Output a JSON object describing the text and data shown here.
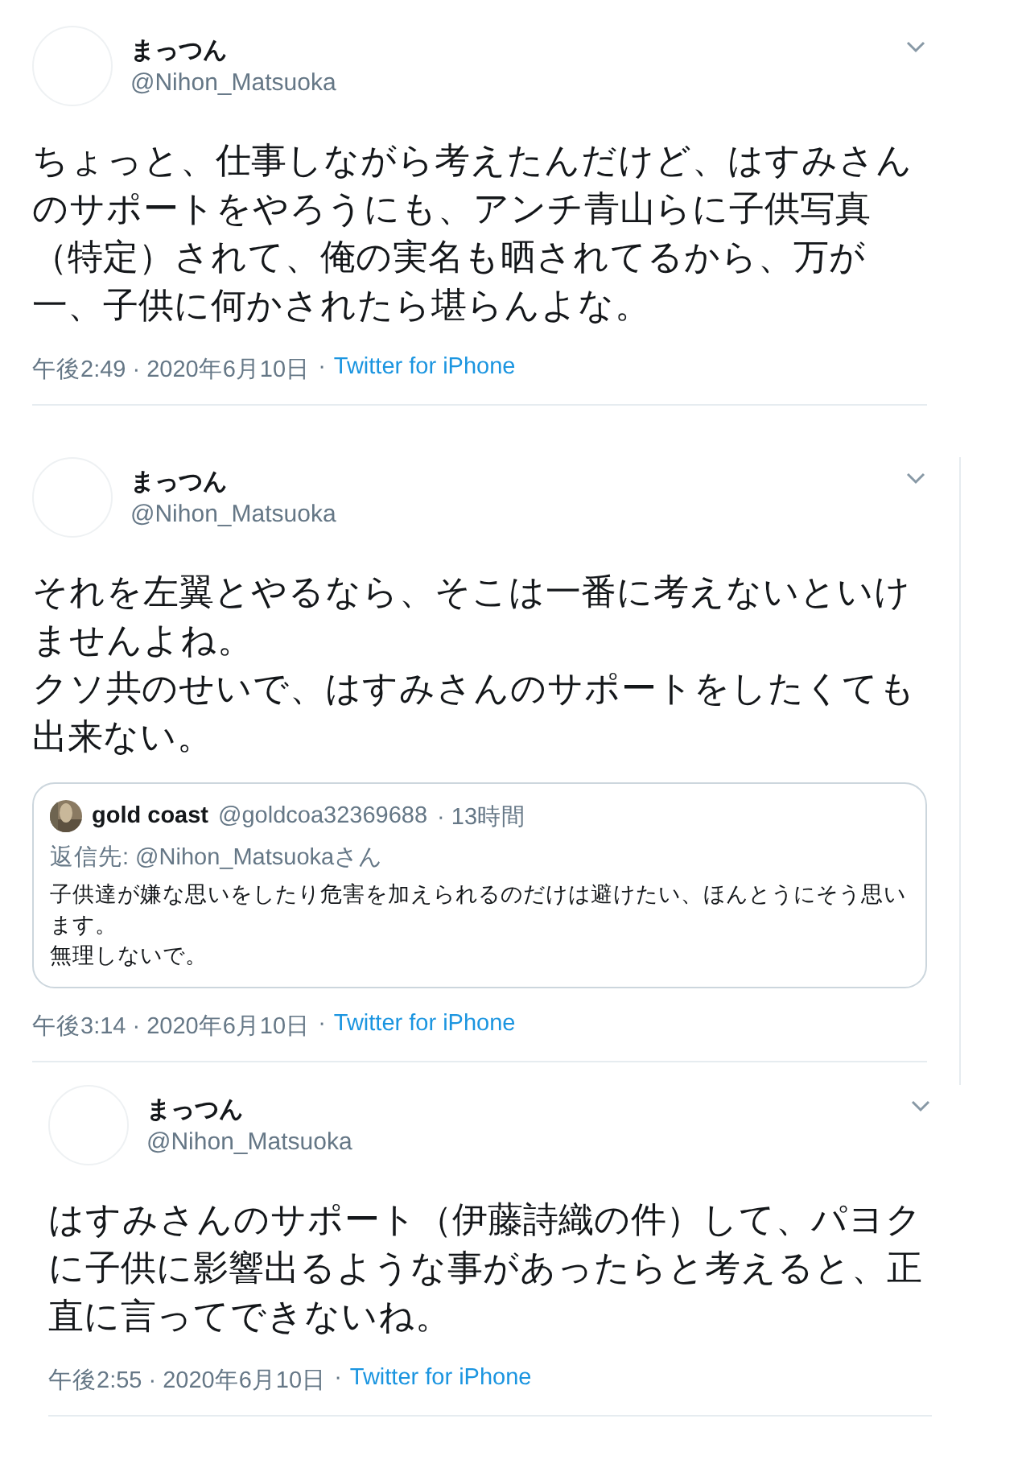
{
  "tweets": [
    {
      "name": "まっつん",
      "handle": "@Nihon_Matsuoka",
      "text": "ちょっと、仕事しながら考えたんだけど、はすみさんのサポートをやろうにも、アンチ青山らに子供写真（特定）されて、俺の実名も晒されてるから、万が一、子供に何かされたら堪らんよな。",
      "time": "午後2:49 · 2020年6月10日",
      "separator": "·",
      "source": "Twitter for iPhone",
      "indent": false,
      "thread_line": false
    },
    {
      "name": "まっつん",
      "handle": "@Nihon_Matsuoka",
      "text": "それを左翼とやるなら、そこは一番に考えないといけませんよね。",
      "text_2": "クソ共のせいで、はすみさんのサポートをしたくても出来ない。",
      "quote": {
        "name": "gold coast",
        "handle": "@goldcoa32369688",
        "age": "· 13時間",
        "reply_to": "返信先: @Nihon_Matsuokaさん",
        "text": "子供達が嫌な思いをしたり危害を加えられるのだけは避けたい、ほんとうにそう思います。",
        "text_2": "無理しないで。"
      },
      "time": "午後3:14 · 2020年6月10日",
      "separator": "·",
      "source": "Twitter for iPhone",
      "indent": false,
      "thread_line": true
    },
    {
      "name": "まっつん",
      "handle": "@Nihon_Matsuoka",
      "text": "はすみさんのサポート（伊藤詩織の件）して、パヨクに子供に影響出るような事があったらと考えると、正直に言ってできないね。",
      "time": "午後2:55 · 2020年6月10日",
      "separator": "·",
      "source": "Twitter for iPhone",
      "indent": true,
      "thread_line": false
    }
  ]
}
